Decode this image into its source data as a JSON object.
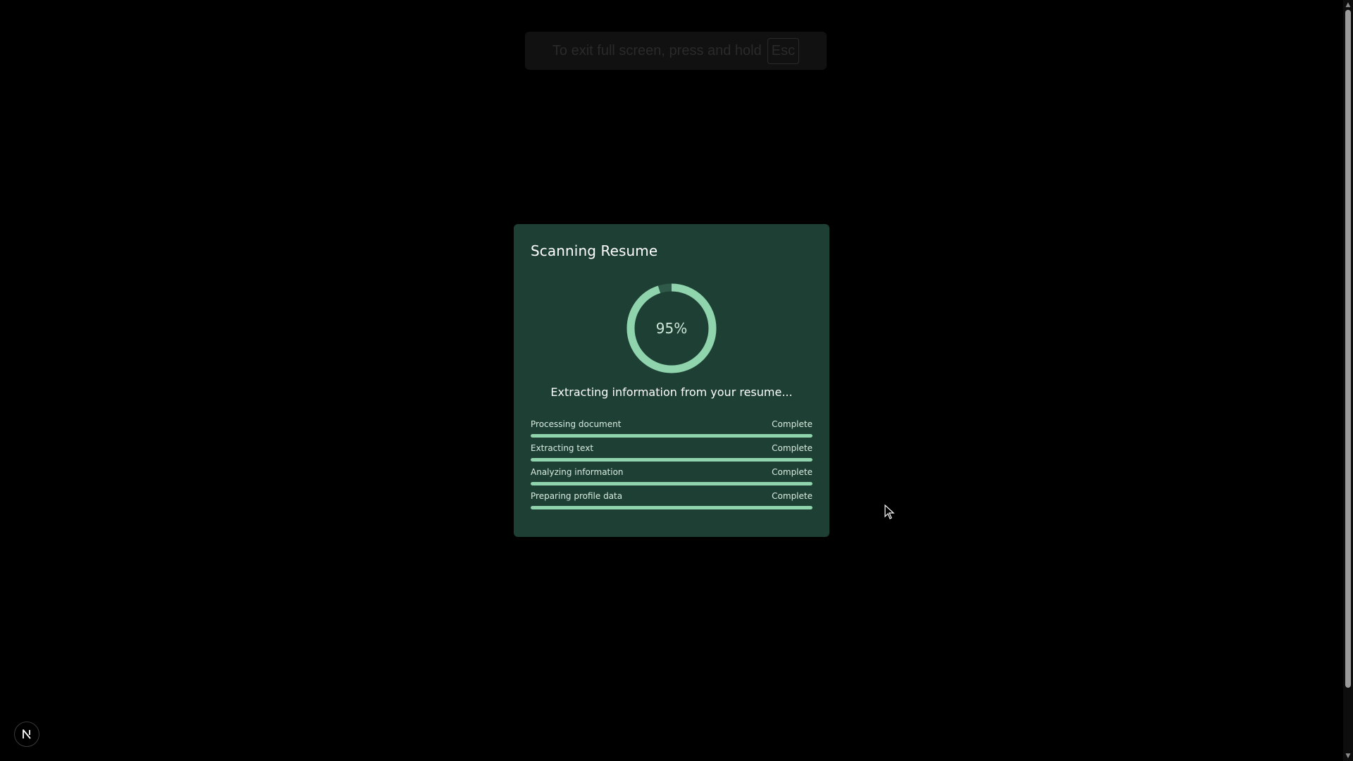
{
  "fullscreen_banner": {
    "text": "To exit full screen, press and hold",
    "key": "Esc"
  },
  "modal": {
    "title": "Scanning Resume",
    "progress_percent": 95,
    "progress_label": "95%",
    "status_text": "Extracting information from your resume...",
    "steps": [
      {
        "label": "Processing document",
        "status": "Complete",
        "progress": 1.0
      },
      {
        "label": "Extracting text",
        "status": "Complete",
        "progress": 1.0
      },
      {
        "label": "Analyzing information",
        "status": "Complete",
        "progress": 1.0
      },
      {
        "label": "Preparing profile data",
        "status": "Complete",
        "progress": 1.0
      }
    ]
  },
  "dev_badge": {
    "icon": "nextjs-logo-icon"
  },
  "colors": {
    "background": "#000000",
    "modal_bg": "#1e3f33",
    "accent": "#8fd4ad",
    "track": "#2f5a49"
  }
}
